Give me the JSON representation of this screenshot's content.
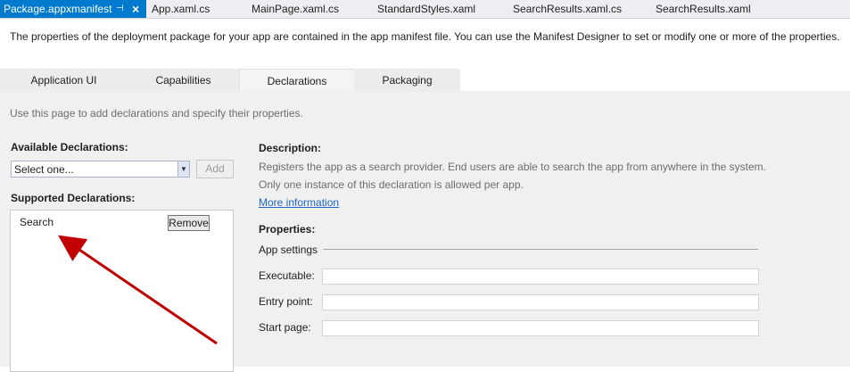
{
  "doc_tabs": {
    "active": "Package.appxmanifest",
    "others": [
      "App.xaml.cs",
      "MainPage.xaml.cs",
      "StandardStyles.xaml",
      "SearchResults.xaml.cs",
      "SearchResults.xaml"
    ],
    "pin_icon": "pin-icon",
    "close_icon": "close-icon"
  },
  "intro_text": "The properties of the deployment package for your app are contained in the app manifest file. You can use the Manifest Designer to set or modify one or more of the properties.",
  "tabs": [
    "Application UI",
    "Capabilities",
    "Declarations",
    "Packaging"
  ],
  "active_tab": "Declarations",
  "page": {
    "hint": "Use this page to add declarations and specify their properties.",
    "available_label": "Available Declarations:",
    "select_value": "Select one...",
    "add_label": "Add",
    "supported_label": "Supported Declarations:",
    "supported_items": [
      {
        "name": "Search",
        "remove_label": "Remove"
      }
    ],
    "description_label": "Description:",
    "description_lines": [
      "Registers the app as a search provider. End users are able to search the app from anywhere in the system.",
      "Only one instance of this declaration is allowed per app."
    ],
    "more_info": "More information",
    "properties_label": "Properties:",
    "app_settings_label": "App settings",
    "fields": [
      {
        "label": "Executable:",
        "value": ""
      },
      {
        "label": "Entry point:",
        "value": ""
      },
      {
        "label": "Start page:",
        "value": ""
      }
    ]
  },
  "colors": {
    "accent": "#007acc",
    "arrow": "#c00000",
    "link": "#1e66c8"
  }
}
